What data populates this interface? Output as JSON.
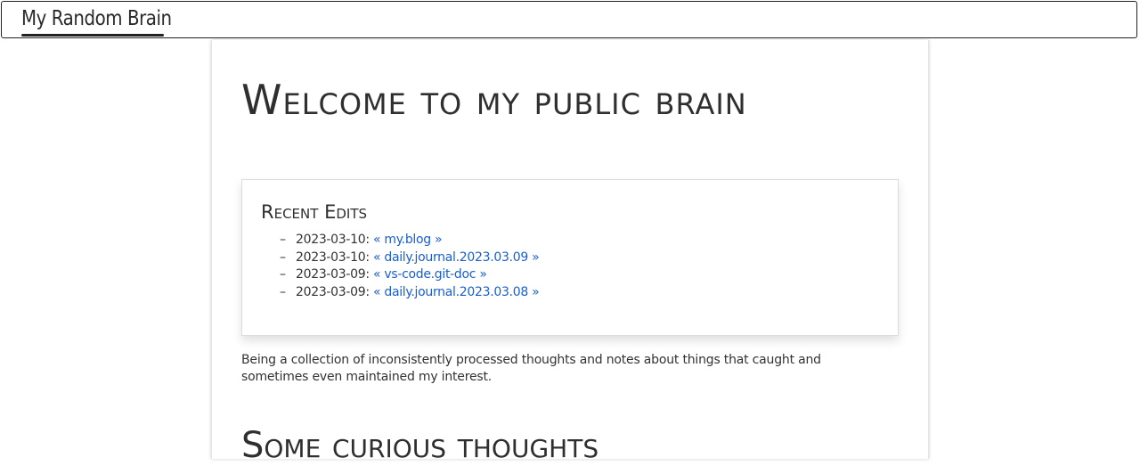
{
  "header": {
    "site_title": "My Random Brain"
  },
  "main": {
    "title": "Welcome to my public brain",
    "recent_edits": {
      "heading": "Recent Edits",
      "items": [
        {
          "date": "2023-03-10:",
          "link": "« my.blog »"
        },
        {
          "date": "2023-03-10:",
          "link": "« daily.journal.2023.03.09 »"
        },
        {
          "date": "2023-03-09:",
          "link": "« vs-code.git-doc »"
        },
        {
          "date": "2023-03-09:",
          "link": "« daily.journal.2023.03.08 »"
        }
      ]
    },
    "intro": "Being a collection of inconsistently processed thoughts and notes about things that caught and sometimes even maintained my interest.",
    "next_heading": "Some curious thoughts"
  },
  "colors": {
    "link": "#1a5fd1",
    "text": "#333333"
  }
}
